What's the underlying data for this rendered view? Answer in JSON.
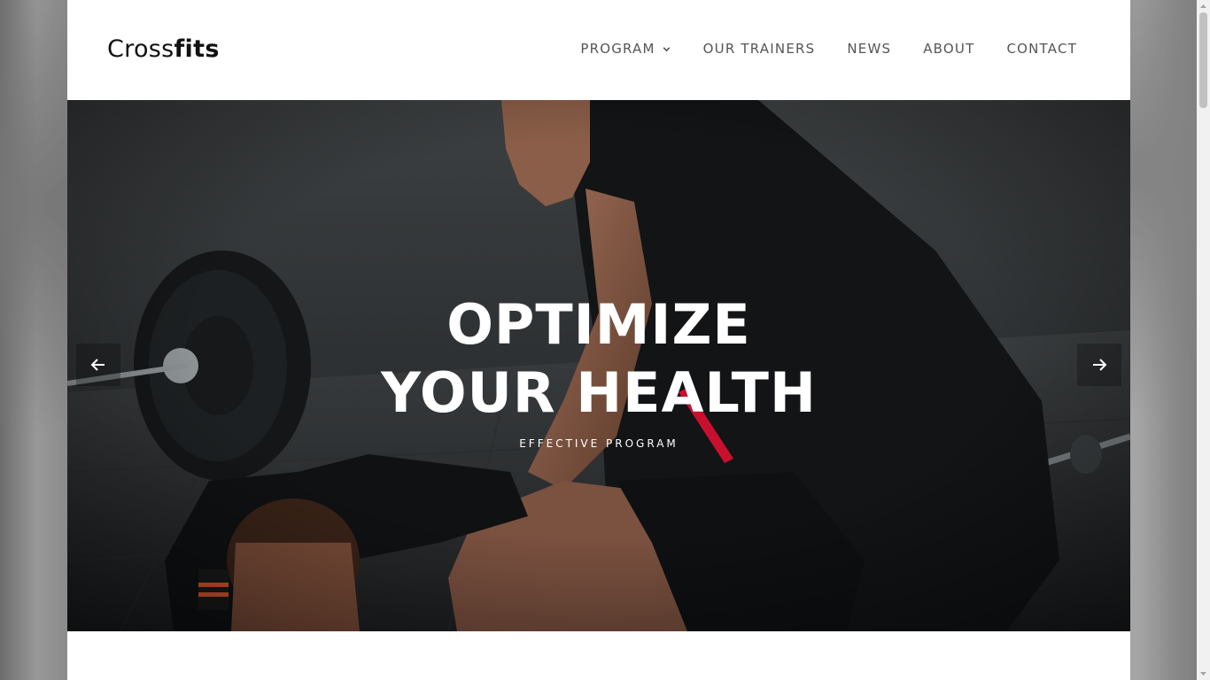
{
  "brand": {
    "logo_light": "Cross",
    "logo_bold": "fits"
  },
  "nav": {
    "items": [
      {
        "label": "PROGRAM",
        "has_dropdown": true
      },
      {
        "label": "OUR TRAINERS"
      },
      {
        "label": "NEWS"
      },
      {
        "label": "ABOUT"
      },
      {
        "label": "CONTACT"
      }
    ]
  },
  "hero": {
    "title": "OPTIMIZE YOUR HEALTH",
    "subtitle": "EFFECTIVE PROGRAM",
    "prev_icon": "arrow-left-icon",
    "next_icon": "arrow-right-icon"
  },
  "colors": {
    "text_dark": "#111111",
    "nav_text": "#555555",
    "hero_text": "#ffffff",
    "accent_red": "#c8102e"
  }
}
